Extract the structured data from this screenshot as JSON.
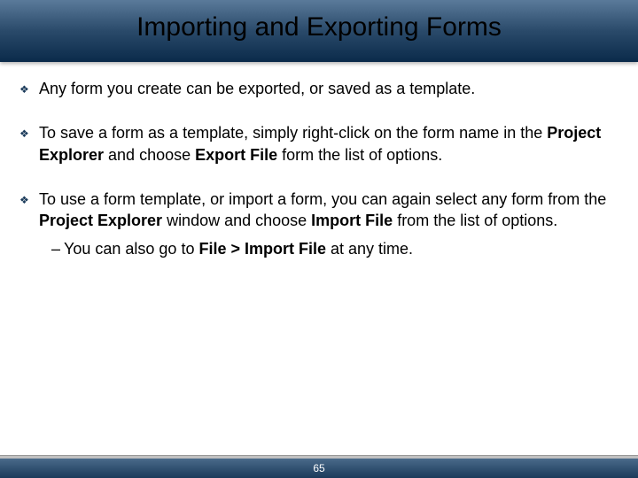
{
  "title": "Importing and Exporting Forms",
  "bullets": {
    "b0": "Any form you create can be exported, or saved as a template.",
    "b1a": "To save a form as a template, simply right-click on the form name in the ",
    "b1b": "Project Explorer",
    "b1c": " and choose ",
    "b1d": "Export File",
    "b1e": " form the list of options.",
    "b2a": "To use a form template, or import a form, you can again select any form from the ",
    "b2b": "Project Explorer",
    "b2c": " window and choose ",
    "b2d": "Import File",
    "b2e": " from the list of options.",
    "sub_a": "You can also go to ",
    "sub_b": "File > Import File",
    "sub_c": " at any time."
  },
  "page_number": "65"
}
